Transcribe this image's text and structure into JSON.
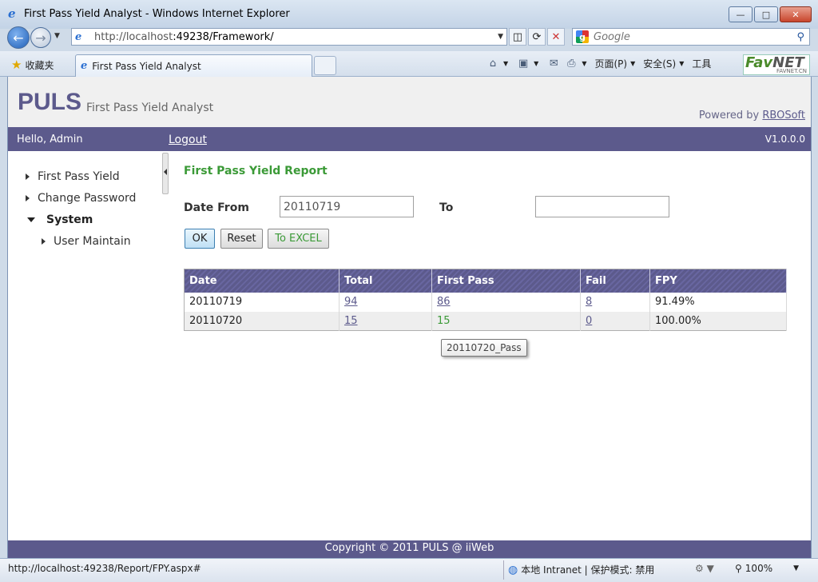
{
  "window": {
    "title": "First Pass Yield Analyst - Windows Internet Explorer",
    "minimize": "—",
    "maximize": "□",
    "close": "✕"
  },
  "browser": {
    "url_prefix": "http://localhost",
    "url_rest": ":49238/Framework/",
    "search_placeholder": "Google",
    "favorites_label": "收藏夹",
    "tab_title": "First Pass Yield Analyst",
    "cmd_page": "页面(P)",
    "cmd_safety": "安全(S)",
    "cmd_tools": "工具",
    "badge_brand": "Fav",
    "badge_brand2": "NET",
    "badge_sub": "FAVNET.CN"
  },
  "header": {
    "logo": "PULS",
    "subtitle": "First Pass Yield Analyst",
    "powered_prefix": "Powered by ",
    "powered_link": "RBOSoft"
  },
  "menubar": {
    "hello": "Hello, Admin",
    "logout": "Logout",
    "version": "V1.0.0.0"
  },
  "sidebar": {
    "items": [
      {
        "label": "First Pass Yield"
      },
      {
        "label": "Change Password"
      },
      {
        "label": "System"
      },
      {
        "label": "User Maintain"
      }
    ]
  },
  "report": {
    "title": "First Pass Yield Report",
    "date_from_label": "Date From",
    "date_from_value": "20110719",
    "to_label": "To",
    "to_value": "",
    "ok": "OK",
    "reset": "Reset",
    "excel": "To EXCEL"
  },
  "table": {
    "headers": [
      "Date",
      "Total",
      "First Pass",
      "Fail",
      "FPY"
    ],
    "rows": [
      {
        "date": "20110719",
        "total": "94",
        "first_pass": "86",
        "fail": "8",
        "fpy": "91.49%"
      },
      {
        "date": "20110720",
        "total": "15",
        "first_pass": "15",
        "fail": "0",
        "fpy": "100.00%"
      }
    ]
  },
  "tooltip": "20110720_Pass",
  "footer": "Copyright © 2011 PULS @ iiWeb",
  "statusbar": {
    "status": "http://localhost:49238/Report/FPY.aspx#",
    "zone": "本地 Intranet | 保护模式: 禁用",
    "zoom": "100%"
  }
}
